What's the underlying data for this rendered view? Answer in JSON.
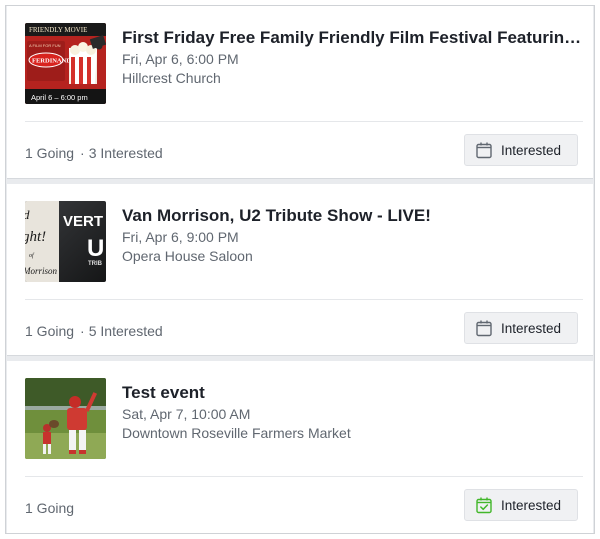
{
  "events": [
    {
      "title": "First Friday Free Family Friendly Film Festival Featuring: Ferdinand",
      "datetime": "Fri, Apr 6, 6:00 PM",
      "location": "Hillcrest Church",
      "going": "1 Going",
      "dot": "·",
      "interested_count": "3 Interested",
      "button_label": "Interested",
      "button_icon": "calendar-icon",
      "thumb": {
        "header": "FRIENDLY MOVIE",
        "brand": "FERDINAND",
        "footer": "April 6 – 6:00 pm"
      }
    },
    {
      "title": "Van Morrison, U2 Tribute Show - LIVE!",
      "datetime": "Fri, Apr 6, 9:00 PM",
      "location": "Opera House Saloon",
      "going": "1 Going",
      "dot": "·",
      "interested_count": "5 Interested",
      "button_label": "Interested",
      "button_icon": "calendar-icon",
      "thumb": {
        "word1": "VERT",
        "word2": "U",
        "word3": "TRIB",
        "left1": "d",
        "left2": "ght!",
        "left3": "of",
        "left4": "Morrison"
      }
    },
    {
      "title": "Test event",
      "datetime": "Sat, Apr 7, 10:00 AM",
      "location": "Downtown Roseville Farmers Market",
      "going": "1 Going",
      "button_label": "Interested",
      "button_icon": "calendar-check-icon"
    }
  ],
  "colors": {
    "accent_green": "#42b72a",
    "text_primary": "#1d2129",
    "text_secondary": "#606770"
  }
}
